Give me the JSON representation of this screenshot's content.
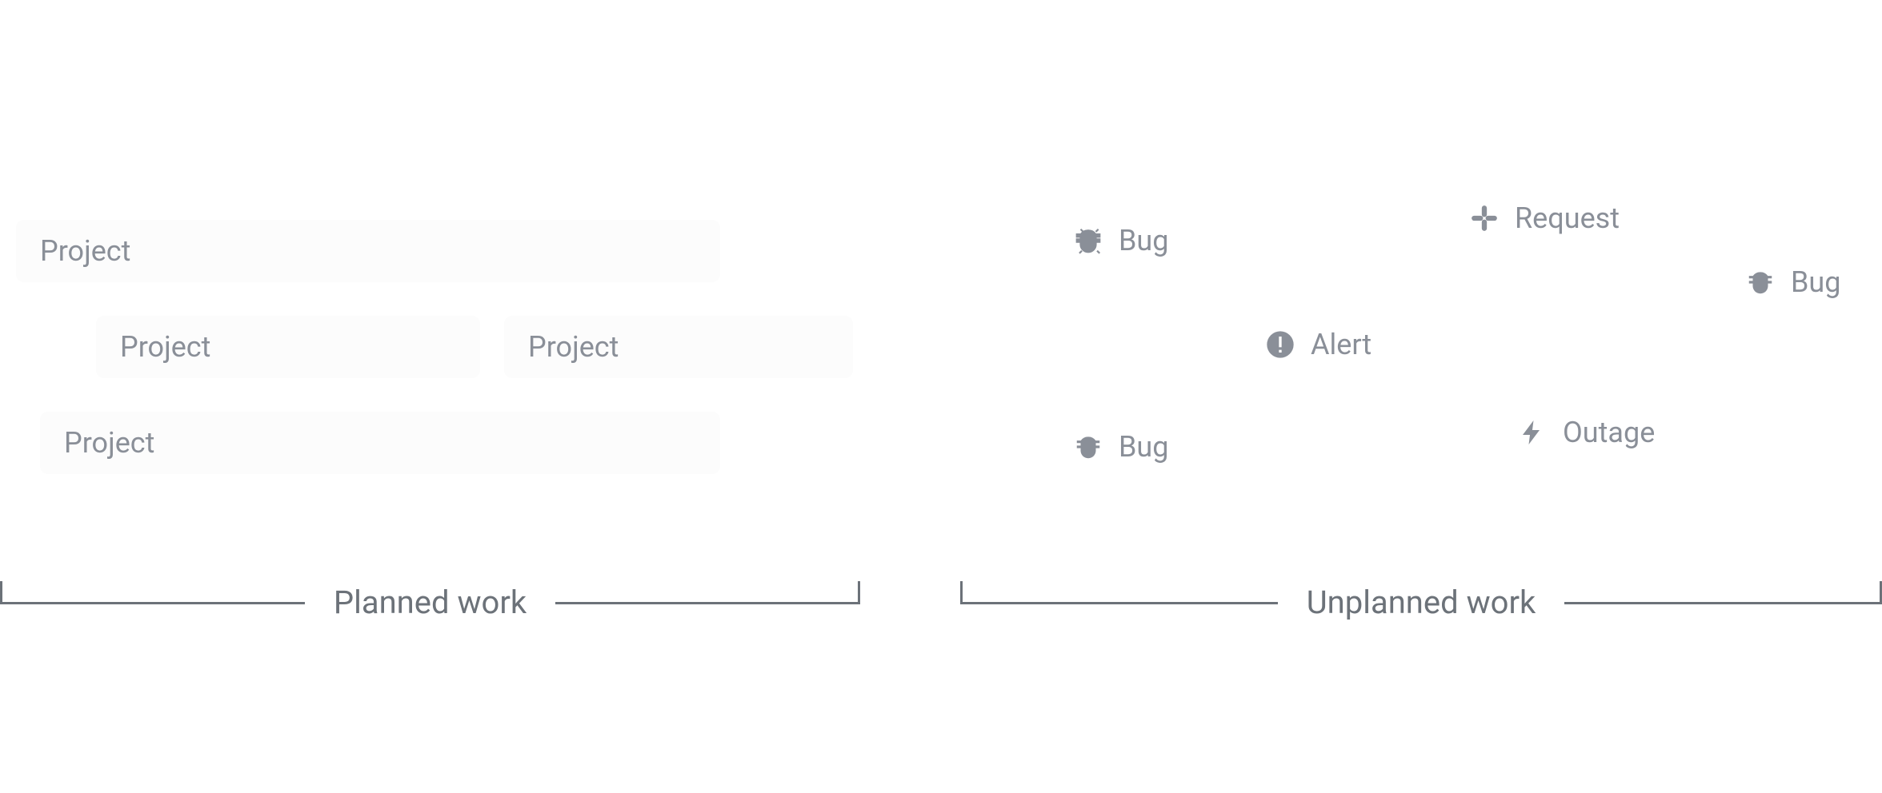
{
  "planned": {
    "label": "Planned work",
    "cards": [
      {
        "label": "Project"
      },
      {
        "label": "Project"
      },
      {
        "label": "Project"
      },
      {
        "label": "Project"
      }
    ]
  },
  "unplanned": {
    "label": "Unplanned work",
    "items": [
      {
        "label": "Bug",
        "icon": "bug-icon"
      },
      {
        "label": "Request",
        "icon": "request-icon"
      },
      {
        "label": "Bug",
        "icon": "bug-icon"
      },
      {
        "label": "Alert",
        "icon": "alert-icon"
      },
      {
        "label": "Bug",
        "icon": "bug-icon"
      },
      {
        "label": "Outage",
        "icon": "outage-icon"
      }
    ]
  }
}
